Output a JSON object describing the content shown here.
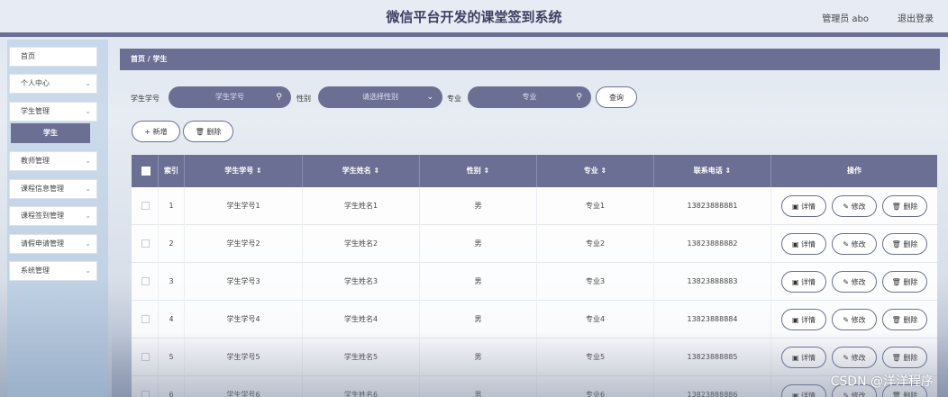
{
  "header": {
    "title": "微信平台开发的课堂签到系统",
    "user": "管理员 abo",
    "logout": "退出登录"
  },
  "sidebar": {
    "items": [
      {
        "label": "首页",
        "chevron": ""
      },
      {
        "label": "个人中心",
        "chevron": "⌄"
      },
      {
        "label": "学生管理",
        "chevron": "⌄"
      },
      {
        "label": "教师管理",
        "chevron": "⌄"
      },
      {
        "label": "课程信息管理",
        "chevron": "⌄"
      },
      {
        "label": "课程签到管理",
        "chevron": "⌄"
      },
      {
        "label": "请假申请管理",
        "chevron": "⌄"
      },
      {
        "label": "系统管理",
        "chevron": "⌄"
      }
    ],
    "active_sub": "学生"
  },
  "breadcrumb": "首页 / 学生",
  "search": {
    "student_no_label": "学生学号",
    "student_no_placeholder": "学生学号",
    "gender_label": "性别",
    "gender_placeholder": "请选择性别",
    "major_label": "专业",
    "major_placeholder": "专业",
    "query_button": "查询"
  },
  "actions": {
    "add": "+ 新增",
    "delete": "🗑 删除"
  },
  "icons": {
    "search": "search-icon",
    "chevron": "chevron-down-icon"
  },
  "table": {
    "columns": [
      "索引",
      "学生学号 ⇕",
      "学生姓名 ⇕",
      "性别 ⇕",
      "专业 ⇕",
      "联系电话 ⇕",
      "操作"
    ],
    "op_labels": {
      "detail": "▣ 详情",
      "edit": "✎ 修改",
      "remove": "🗑 删除"
    },
    "rows": [
      {
        "index": "1",
        "no": "学生学号1",
        "name": "学生姓名1",
        "gender": "男",
        "major": "专业1",
        "phone": "13823888881"
      },
      {
        "index": "2",
        "no": "学生学号2",
        "name": "学生姓名2",
        "gender": "男",
        "major": "专业2",
        "phone": "13823888882"
      },
      {
        "index": "3",
        "no": "学生学号3",
        "name": "学生姓名3",
        "gender": "男",
        "major": "专业3",
        "phone": "13823888883"
      },
      {
        "index": "4",
        "no": "学生学号4",
        "name": "学生姓名4",
        "gender": "男",
        "major": "专业4",
        "phone": "13823888884"
      },
      {
        "index": "5",
        "no": "学生学号5",
        "name": "学生姓名5",
        "gender": "男",
        "major": "专业5",
        "phone": "13823888885"
      },
      {
        "index": "6",
        "no": "学生学号6",
        "name": "学生姓名6",
        "gender": "男",
        "major": "专业6",
        "phone": "13823888886"
      }
    ]
  },
  "watermark": "CSDN @洋洋程序",
  "colors": {
    "accent": "#6b6f93",
    "header_bg": "#e6ebf4"
  }
}
